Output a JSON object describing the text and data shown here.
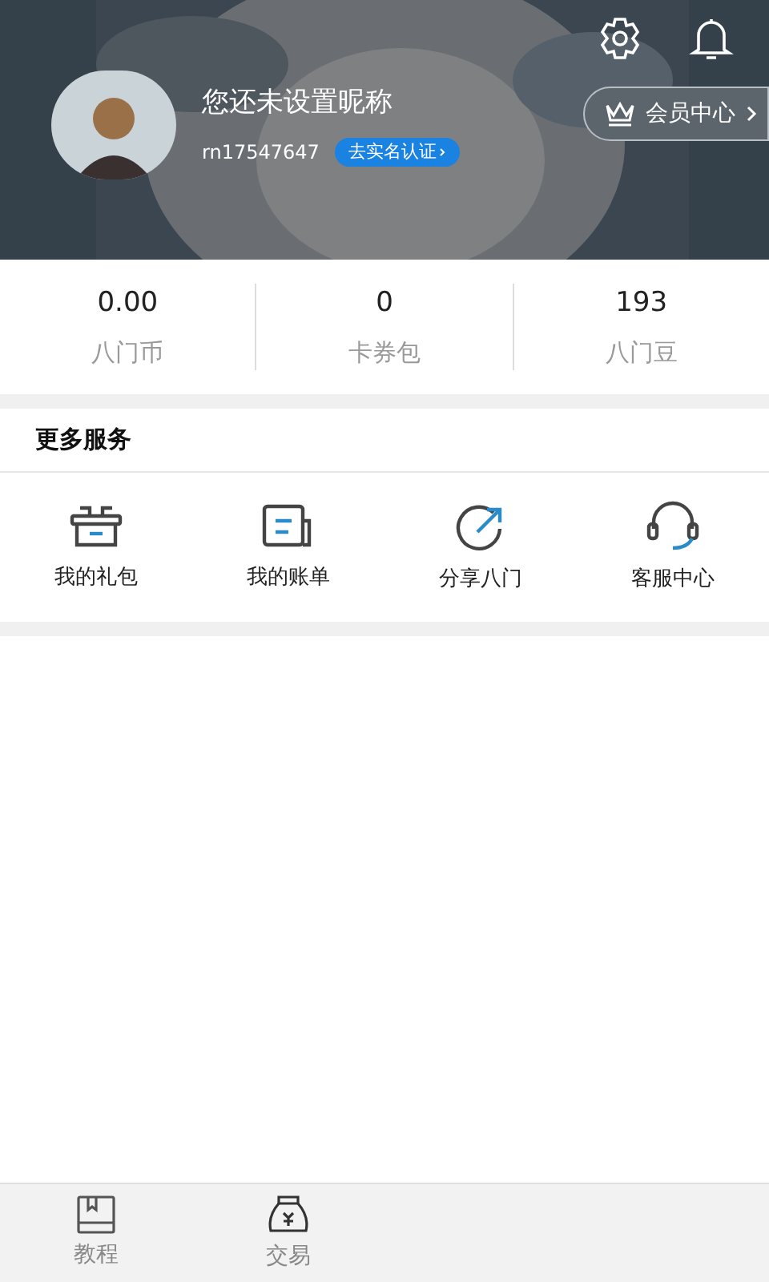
{
  "profile": {
    "nickname": "您还未设置昵称",
    "user_id": "rn17547647",
    "verify_badge": "去实名认证",
    "member_center": "会员中心"
  },
  "stats": [
    {
      "value": "0.00",
      "label": "八门币"
    },
    {
      "value": "0",
      "label": "卡券包"
    },
    {
      "value": "193",
      "label": "八门豆"
    }
  ],
  "services": {
    "title": "更多服务",
    "items": [
      {
        "kind": "gift",
        "label": "我的礼包"
      },
      {
        "kind": "bill",
        "label": "我的账单"
      },
      {
        "kind": "share",
        "label": "分享八门"
      },
      {
        "kind": "support",
        "label": "客服中心"
      }
    ]
  },
  "bottom_nav": [
    {
      "kind": "book",
      "label": "教程"
    },
    {
      "kind": "bag",
      "label": "交易"
    }
  ]
}
